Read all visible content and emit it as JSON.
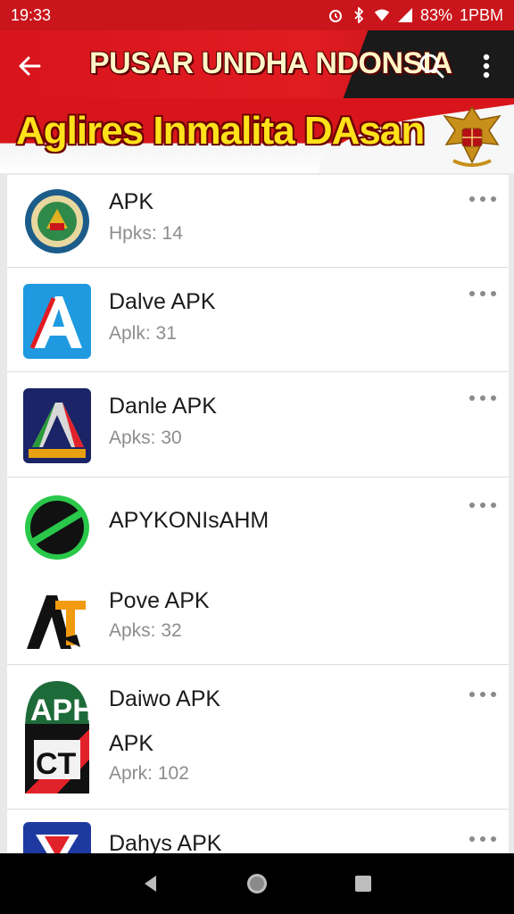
{
  "status_bar": {
    "time": "19:33",
    "battery": "83%",
    "right_text": "1PBM",
    "icons": [
      "alarm-icon",
      "bluetooth-icon",
      "wifi-icon",
      "signal-icon"
    ]
  },
  "app_bar": {
    "title": "PUSAR UNDHA NDONSIA",
    "icons": [
      "back-arrow-icon",
      "search-icon",
      "more-vert-icon"
    ]
  },
  "banner": {
    "text": "Aglires Inmalita DAsan",
    "emblem": "garuda-emblem"
  },
  "list": {
    "items": [
      {
        "title": "APK",
        "subtitle": "Hpks: 14",
        "icon": "round-badge-icon"
      },
      {
        "title": "Dalve APK",
        "subtitle": "Aplk: 31",
        "icon": "blue-a-icon"
      },
      {
        "title": "Danle APK",
        "subtitle": "Apks: 30",
        "icon": "navy-a-icon"
      },
      {
        "title": "APYKONIsAHM",
        "subtitle": "",
        "icon": "green-circle-icon"
      },
      {
        "title": "Pove APK",
        "subtitle": "Apks: 32",
        "icon": "at-logo-icon"
      },
      {
        "title": "Daiwo APK",
        "subtitle": "",
        "icon": "green-ap-icon"
      },
      {
        "title": "APK",
        "subtitle": "Aprk: 102",
        "icon": "red-ct-icon"
      },
      {
        "title": "Dahys APK",
        "subtitle": "",
        "icon": "blue-v-icon"
      }
    ]
  },
  "colors": {
    "primary_red": "#d8141c",
    "banner_yellow": "#ffe21a",
    "title_text": "#1b1b1b",
    "subtitle_text": "#8d8d8d"
  },
  "nav_bar": {
    "icons": [
      "back-triangle-icon",
      "home-circle-icon",
      "recents-square-icon"
    ]
  }
}
